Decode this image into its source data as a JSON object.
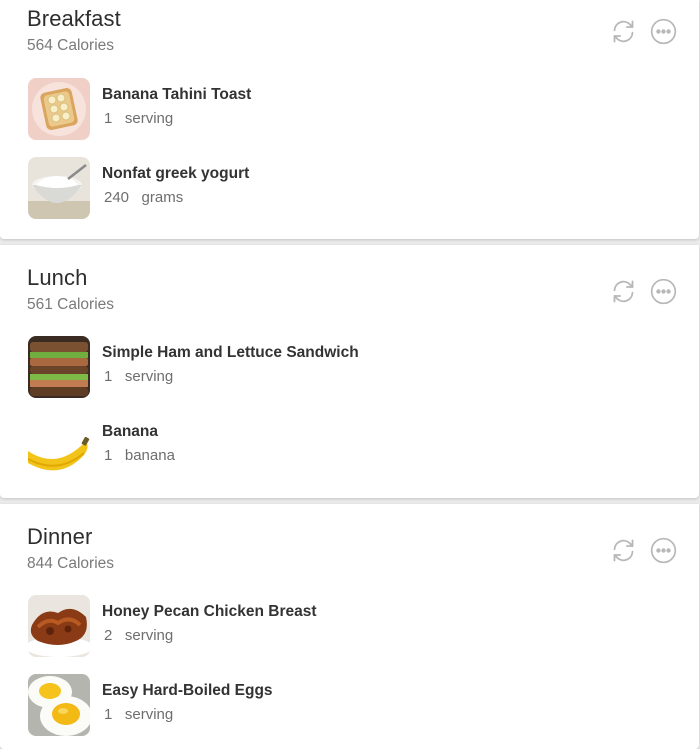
{
  "meals": [
    {
      "title": "Breakfast",
      "calories": "564 Calories",
      "foods": [
        {
          "name": "Banana Tahini Toast",
          "amount": "1",
          "unit": "serving",
          "image": "toast-image"
        },
        {
          "name": "Nonfat greek yogurt",
          "amount": "240",
          "unit": "grams",
          "image": "yogurt-image"
        }
      ]
    },
    {
      "title": "Lunch",
      "calories": "561 Calories",
      "foods": [
        {
          "name": "Simple Ham and Lettuce Sandwich",
          "amount": "1",
          "unit": "serving",
          "image": "sandwich-image"
        },
        {
          "name": "Banana",
          "amount": "1",
          "unit": "banana",
          "image": "banana-image"
        }
      ]
    },
    {
      "title": "Dinner",
      "calories": "844 Calories",
      "foods": [
        {
          "name": "Honey Pecan Chicken Breast",
          "amount": "2",
          "unit": "serving",
          "image": "chicken-image"
        },
        {
          "name": "Easy Hard-Boiled Eggs",
          "amount": "1",
          "unit": "serving",
          "image": "eggs-image"
        }
      ]
    }
  ],
  "icons": {
    "regenerate": "refresh-icon",
    "more": "more-options-icon"
  },
  "colors": {
    "icon": "#b8b8b8",
    "text": "#2e2e2e",
    "muted": "#7a7a7a",
    "card": "#ffffff",
    "background": "#ececec"
  }
}
